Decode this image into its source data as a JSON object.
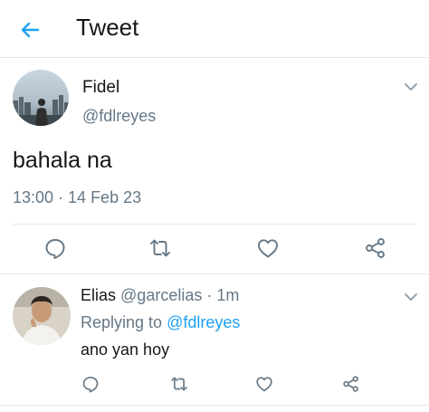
{
  "header": {
    "title": "Tweet",
    "back_icon": "arrow-left-icon",
    "accent_color": "#1da1f2"
  },
  "tweet": {
    "author_name": "Fidel",
    "author_handle": "@fdlreyes",
    "text": "bahala na",
    "timestamp": "13:00 · 14 Feb 23",
    "avatar_icon": "city-skyline-avatar",
    "menu_icon": "chevron-down-icon",
    "actions": [
      {
        "icon": "reply-icon"
      },
      {
        "icon": "retweet-icon"
      },
      {
        "icon": "like-icon"
      },
      {
        "icon": "share-icon"
      }
    ]
  },
  "reply": {
    "author_name": "Elias",
    "author_handle": "@garcelias",
    "separator": "·",
    "time": "1m",
    "replying_label": "Replying to",
    "replying_handle": "@fdlreyes",
    "text": "ano yan hoy",
    "avatar_icon": "person-photo-avatar",
    "menu_icon": "chevron-down-icon",
    "actions": [
      {
        "icon": "reply-icon"
      },
      {
        "icon": "retweet-icon"
      },
      {
        "icon": "like-icon"
      },
      {
        "icon": "share-icon"
      }
    ]
  },
  "colors": {
    "text_primary": "#14171a",
    "text_secondary": "#657786",
    "link": "#1da1f2",
    "border": "#e1e8ed"
  }
}
